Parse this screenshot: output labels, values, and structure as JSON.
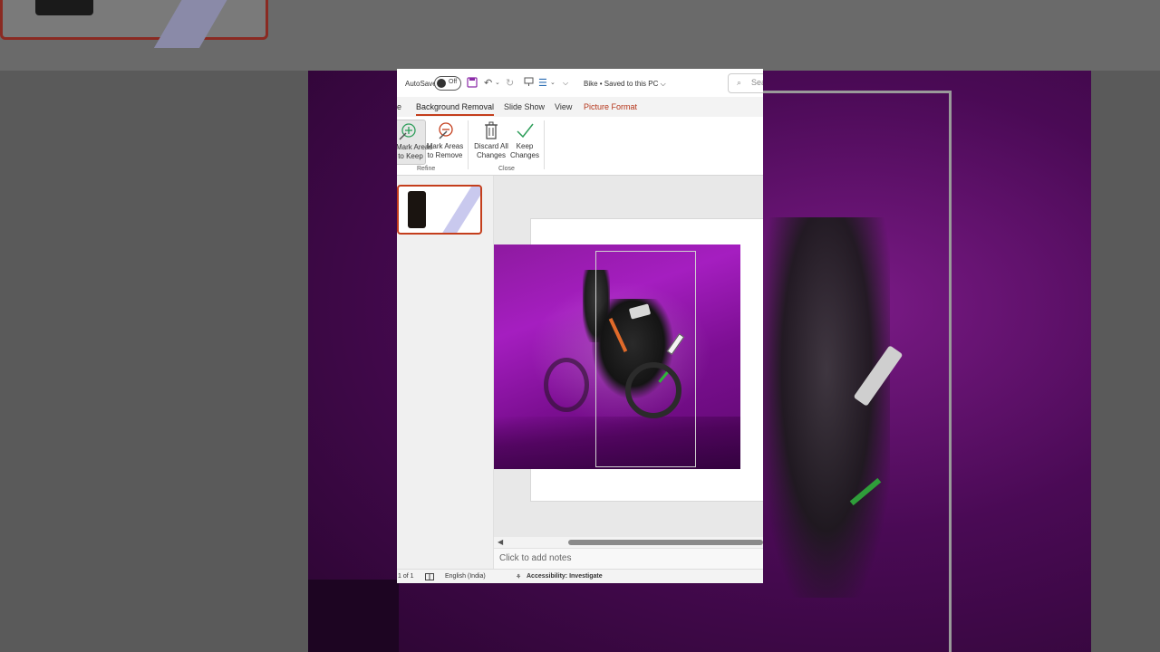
{
  "title_bar": {
    "autosave_label": "AutoSave",
    "toggle_state": "Off",
    "doc_title": "Bike • Saved to this PC ⌵",
    "search_placeholder": "Sea"
  },
  "tabs": [
    {
      "label": "e"
    },
    {
      "label": "Background Removal"
    },
    {
      "label": "Slide Show"
    },
    {
      "label": "View"
    },
    {
      "label": "Picture Format"
    }
  ],
  "ribbon": {
    "mark_keep": {
      "line1": "Mark Areas",
      "line2": "to Keep"
    },
    "mark_remove": {
      "line1": "Mark Areas",
      "line2": "to Remove"
    },
    "discard": {
      "line1": "Discard All",
      "line2": "Changes"
    },
    "keep": {
      "line1": "Keep",
      "line2": "Changes"
    },
    "group_refine": "Refine",
    "group_close": "Close"
  },
  "notes": {
    "placeholder": "Click to add notes"
  },
  "status": {
    "slide_count": "1 of 1",
    "language": "English (India)",
    "accessibility": "Accessibility: Investigate"
  },
  "colors": {
    "accent": "#c43e1c",
    "photo_purple": "#a51ec0"
  }
}
